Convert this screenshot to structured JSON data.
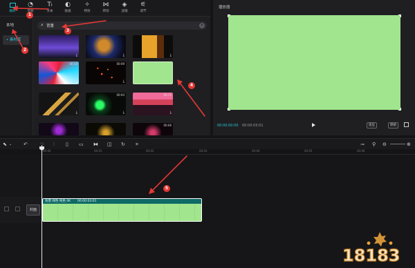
{
  "media_toolbar": {
    "tools": [
      {
        "label": "媒体",
        "icon": "media-icon",
        "active": true
      },
      {
        "label": "音频",
        "icon": "audio-icon"
      },
      {
        "label": "文本",
        "icon": "text-icon"
      },
      {
        "label": "贴纸",
        "icon": "sticker-icon"
      },
      {
        "label": "特效",
        "icon": "effects-icon"
      },
      {
        "label": "转场",
        "icon": "transition-icon"
      },
      {
        "label": "滤镜",
        "icon": "filter-icon"
      },
      {
        "label": "调节",
        "icon": "adjust-icon"
      }
    ]
  },
  "sidebar": {
    "items": [
      {
        "label": "本地"
      },
      {
        "label": "素材库",
        "active": true
      }
    ]
  },
  "search": {
    "value": "背景"
  },
  "thumbnails": [
    {
      "duration": ""
    },
    {
      "duration": ""
    },
    {
      "duration": ""
    },
    {
      "duration": "00:14"
    },
    {
      "duration": "00:09"
    },
    {
      "duration": ""
    },
    {
      "duration": ""
    },
    {
      "duration": "00:04"
    },
    {
      "duration": "00:11"
    },
    {
      "duration": ""
    },
    {
      "duration": ""
    },
    {
      "duration": "00:06"
    }
  ],
  "player": {
    "title": "播放器",
    "current_time": "00:00:00:00",
    "total_time": "00:00:03:01",
    "ratio_button": "适应",
    "original_button": "原始",
    "screen_color": "#a1e58e"
  },
  "timeline": {
    "ruler_labels": [
      "00:00",
      "00:01",
      "00:02",
      "00:03",
      "00:04",
      "00:05",
      "00:06"
    ],
    "cover_label": "封面",
    "clip": {
      "title": "背景 绿色 纯色 4K",
      "duration": "00:00:03:01",
      "color": "#a1e58e"
    }
  },
  "annotations": [
    "1",
    "2",
    "3",
    "4",
    "5"
  ],
  "watermark": {
    "text": "18183"
  },
  "colors": {
    "accent": "#28c7d4",
    "annotation_red": "#e53935"
  }
}
